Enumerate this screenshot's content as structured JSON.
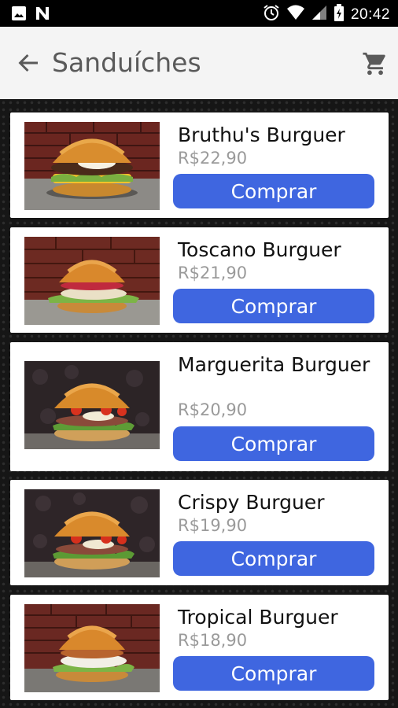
{
  "status_bar": {
    "time": "20:42",
    "left_icons": [
      "image-icon",
      "notification-n-icon"
    ],
    "right_icons": [
      "alarm-icon",
      "wifi-icon",
      "signal-icon",
      "battery-icon"
    ]
  },
  "app_bar": {
    "title": "Sanduíches",
    "back_icon": "arrow-back-icon",
    "cart_icon": "shopping-cart-icon"
  },
  "colors": {
    "accent": "#3f66e0",
    "title": "#5a5a5a",
    "price": "#9a9a9a"
  },
  "products": [
    {
      "name": "Bruthu's Burguer",
      "price": "R$22,90",
      "button": "Comprar"
    },
    {
      "name": "Toscano Burguer",
      "price": "R$21,90",
      "button": "Comprar"
    },
    {
      "name": "Marguerita Burguer",
      "price": "R$20,90",
      "button": "Comprar"
    },
    {
      "name": "Crispy Burguer",
      "price": "R$19,90",
      "button": "Comprar"
    },
    {
      "name": "Tropical Burguer",
      "price": "R$18,90",
      "button": "Comprar"
    }
  ]
}
